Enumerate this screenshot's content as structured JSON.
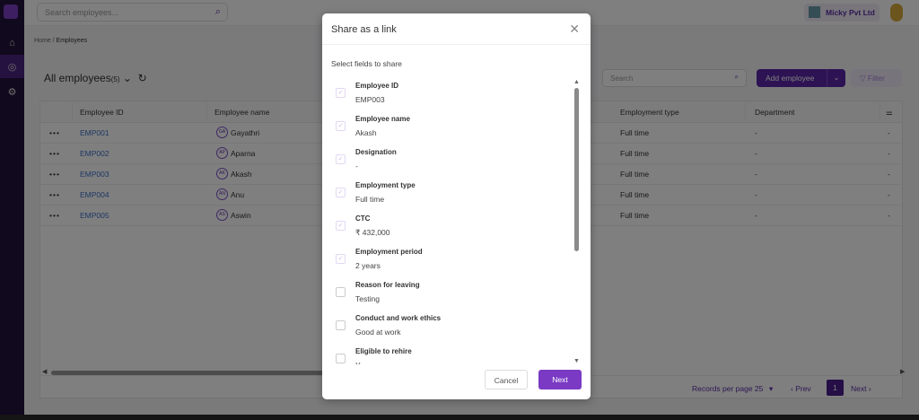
{
  "topbar": {
    "search_placeholder": "Search employees...",
    "org_name": "Micky Pvt Ltd"
  },
  "breadcrumb": {
    "home": "Home",
    "sep": "/",
    "current": "Employees"
  },
  "page": {
    "title": "All employees",
    "count": "(5)",
    "search_placeholder": "Search",
    "add_label": "Add employee",
    "filter_label": "Filter"
  },
  "table": {
    "headers": {
      "id": "Employee ID",
      "name": "Employee name",
      "type": "Employment type",
      "dept": "Department"
    },
    "rows": [
      {
        "id": "EMP001",
        "initials": "GA",
        "name": "Gayathri",
        "type": "Full time",
        "dept": "-",
        "last": "-"
      },
      {
        "id": "EMP002",
        "initials": "AP",
        "name": "Aparna",
        "type": "Full time",
        "dept": "-",
        "last": "-"
      },
      {
        "id": "EMP003",
        "initials": "AK",
        "name": "Akash",
        "type": "Full time",
        "dept": "-",
        "last": "-"
      },
      {
        "id": "EMP004",
        "initials": "AN",
        "name": "Anu",
        "type": "Full time",
        "dept": "-",
        "last": "-"
      },
      {
        "id": "EMP005",
        "initials": "AS",
        "name": "Aswin",
        "type": "Full time",
        "dept": "-",
        "last": "-"
      }
    ]
  },
  "pager": {
    "records": "Records per page 25",
    "prev": "‹ Prev",
    "page": "1",
    "next": "Next ›"
  },
  "modal": {
    "title": "Share as a link",
    "subtitle": "Select fields to share",
    "cancel": "Cancel",
    "next": "Next",
    "fields": [
      {
        "label": "Employee ID",
        "value": "EMP003",
        "checked": true
      },
      {
        "label": "Employee name",
        "value": "Akash",
        "checked": true
      },
      {
        "label": "Designation",
        "value": "-",
        "checked": true
      },
      {
        "label": "Employment type",
        "value": "Full time",
        "checked": true
      },
      {
        "label": "CTC",
        "value": "₹ 432,000",
        "checked": true
      },
      {
        "label": "Employment period",
        "value": "2 years",
        "checked": true
      },
      {
        "label": "Reason for leaving",
        "value": "Testing",
        "checked": false
      },
      {
        "label": "Conduct and work ethics",
        "value": "Good at work",
        "checked": false
      },
      {
        "label": "Eligible to rehire",
        "value": "Y",
        "checked": false
      }
    ]
  },
  "colors": {
    "accent": "#5a26a6",
    "link": "#3a6fc8",
    "next_button": "#7a3ac4"
  }
}
